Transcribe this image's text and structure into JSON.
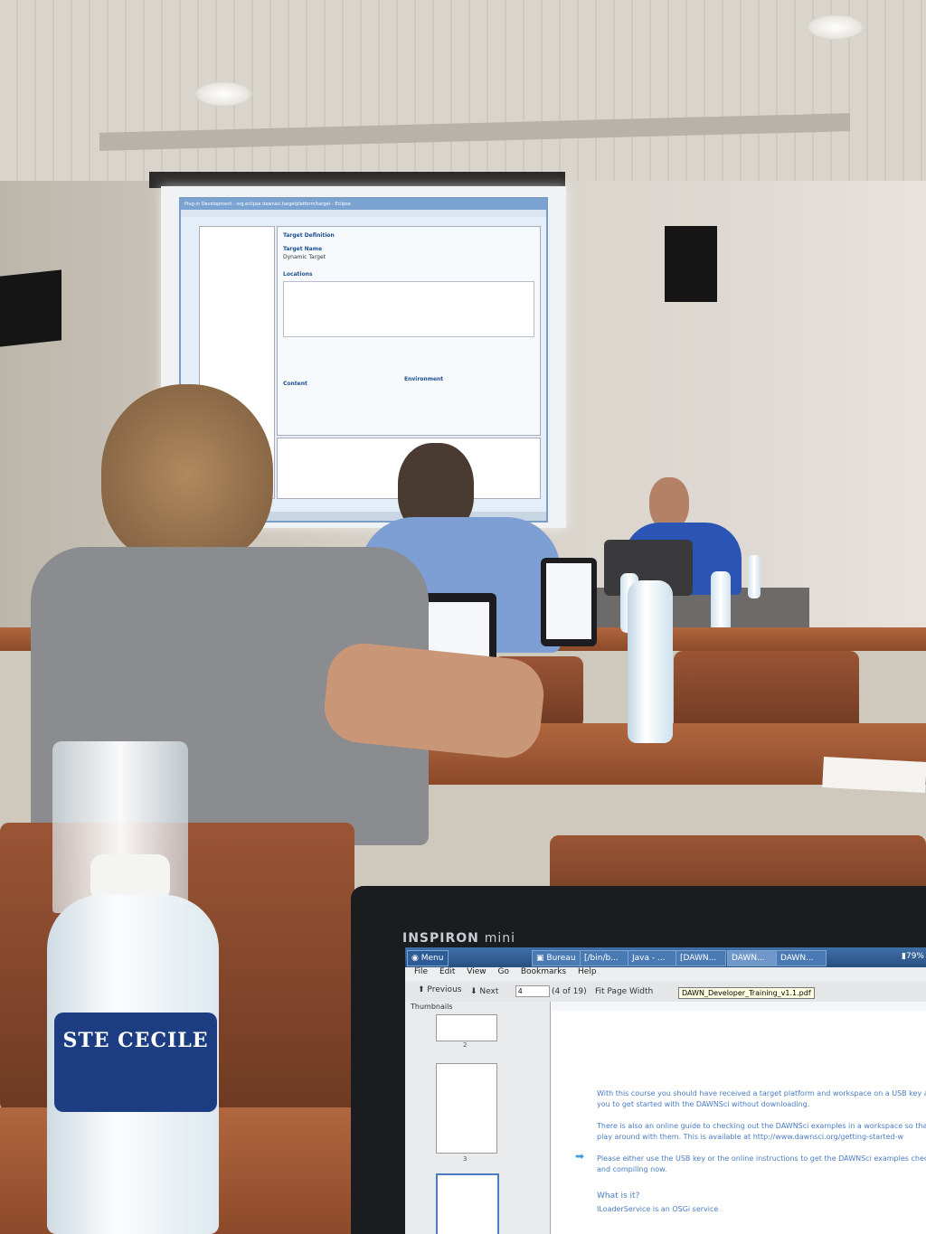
{
  "colors": {
    "accent": "#3f6fa8",
    "table": "#a65d39",
    "shirt_front": "#8a8c8f",
    "shirt_mid": "#7e9fd3"
  },
  "bottle": {
    "brand": "STE CECILE"
  },
  "laptop": {
    "brand": "INSPIRON",
    "model": "mini",
    "taskbar": {
      "menu_label": "Menu",
      "tasks": [
        "Bureau",
        "[/bin/b...",
        "Java - ...",
        "[DAWN...",
        "DAWN...",
        "DAWN..."
      ],
      "battery": "79%"
    },
    "menu": [
      "File",
      "Edit",
      "View",
      "Go",
      "Bookmarks",
      "Help"
    ],
    "toolbar": {
      "previous": "Previous",
      "next": "Next",
      "page_value": "4",
      "page_count": "(4 of 19)",
      "zoom": "Fit Page Width"
    },
    "tooltip": "DAWN_Developer_Training_v1.1.pdf",
    "thumbnails_label": "Thumbnails",
    "thumb_pages": [
      "2",
      "3"
    ],
    "doc_lines": [
      "With this course you should have received a target platform and workspace on a USB key allow",
      "you to get started with the DAWNSci without downloading.",
      "There is also an online guide to checking out the DAWNSci examples in a workspace so that you",
      "play around with them. This is available at http://www.dawnsci.org/getting-started-w",
      "Please either use the USB key or the online instructions to get the DAWNSci examples checked",
      "and compiling now.",
      "What is it?",
      "ILoaderService is an OSGi service"
    ]
  },
  "projector": {
    "window_title": "Plug-in Development - org.eclipse.dawnsci.targetplatform/target - Eclipse",
    "section_title": "Target Definition",
    "target_name_label": "Target Name",
    "target_name_value": "Dynamic Target",
    "locations_label": "Locations",
    "content_label": "Content",
    "environment_label": "Environment"
  }
}
